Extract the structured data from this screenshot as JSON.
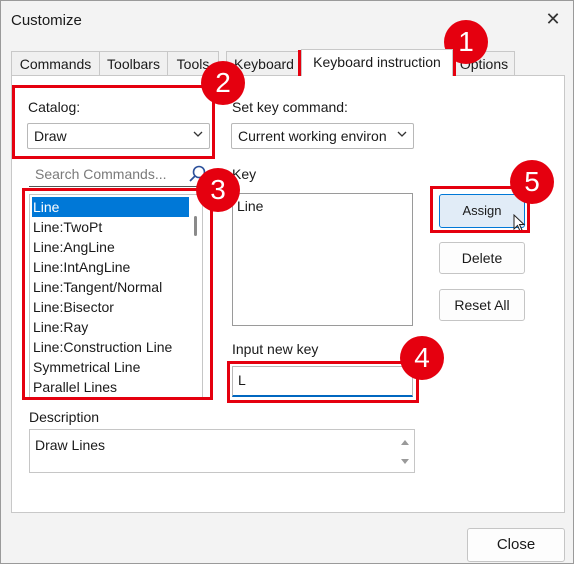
{
  "window": {
    "title": "Customize"
  },
  "tabs": [
    "Commands",
    "Toolbars",
    "Tools",
    "Keyboard",
    "Keyboard instruction",
    "Options"
  ],
  "catalog": {
    "label": "Catalog:",
    "value": "Draw"
  },
  "set_key_command": {
    "label": "Set key command:",
    "value": "Current working environ"
  },
  "search": {
    "placeholder": "Search Commands..."
  },
  "commands": [
    "Line",
    "Line:TwoPt",
    "Line:AngLine",
    "Line:IntAngLine",
    "Line:Tangent/Normal",
    "Line:Bisector",
    "Line:Ray",
    "Line:Construction Line",
    "Symmetrical Line",
    "Parallel Lines"
  ],
  "key": {
    "label": "Key",
    "value": "Line"
  },
  "input_new_key": {
    "label": "Input new key",
    "value": "L"
  },
  "description": {
    "label": "Description",
    "value": "Draw Lines"
  },
  "buttons": {
    "assign": "Assign",
    "delete": "Delete",
    "reset_all": "Reset All",
    "close": "Close"
  },
  "callouts": [
    "1",
    "2",
    "3",
    "4",
    "5"
  ],
  "colors": {
    "callout": "#e5000f",
    "selection": "#0078d7"
  }
}
